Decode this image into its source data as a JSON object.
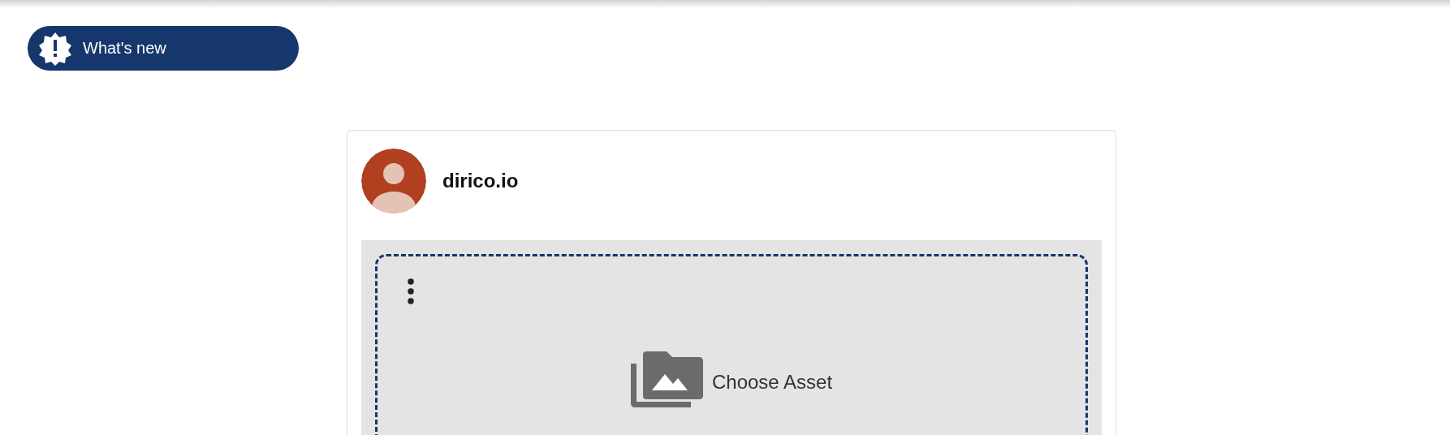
{
  "whats_new_button": {
    "label": "What's new"
  },
  "post": {
    "author": "dirico.io",
    "asset_picker": {
      "label": "Choose Asset"
    }
  }
}
